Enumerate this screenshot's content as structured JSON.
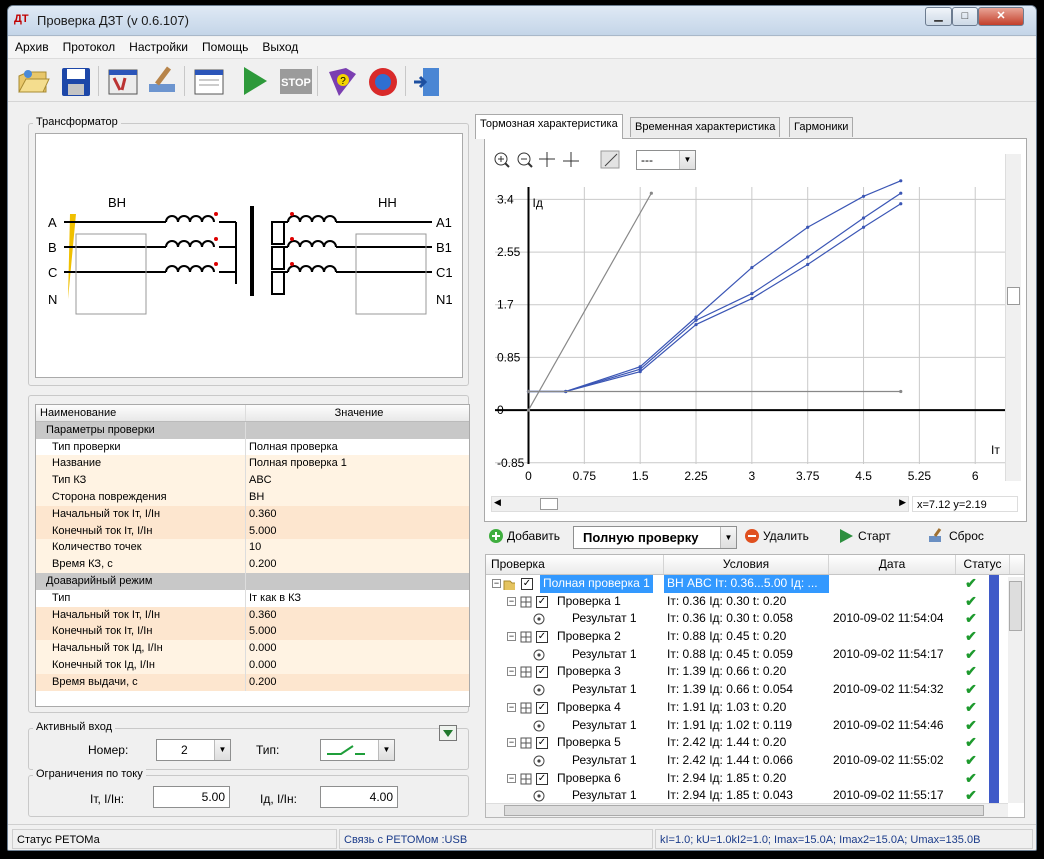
{
  "window": {
    "title": "Проверка ДЗТ (v 0.6.107)",
    "app_icon_text": "ДТ"
  },
  "menu": [
    "Архив",
    "Протокол",
    "Настройки",
    "Помощь",
    "Выход"
  ],
  "toolbar": [
    "open-folder-icon",
    "save-icon",
    "settings-icon",
    "brush-icon",
    "window-icon",
    "play-icon",
    "stop-icon",
    "help-book-icon",
    "lifebuoy-icon",
    "exit-door-icon"
  ],
  "toolbar_stop_label": "STOP",
  "transformer": {
    "legend": "Трансформатор",
    "hv_label": "ВН",
    "lv_label": "НН",
    "hv_phases": [
      "A",
      "B",
      "C",
      "N"
    ],
    "lv_phases": [
      "A1",
      "B1",
      "C1",
      "N1"
    ]
  },
  "params": {
    "col_name": "Наименование",
    "col_value": "Значение",
    "rows": [
      {
        "type": "section",
        "name": "Параметры проверки",
        "value": ""
      },
      {
        "type": "white",
        "name": "Тип проверки",
        "value": "Полная проверка"
      },
      {
        "type": "odd",
        "name": "Название",
        "value": "Полная проверка 1"
      },
      {
        "type": "odd",
        "name": "Тип КЗ",
        "value": "ABC"
      },
      {
        "type": "odd",
        "name": "Сторона повреждения",
        "value": "ВН"
      },
      {
        "type": "even",
        "name": "Начальный ток Iт, I/Iн",
        "value": "0.360"
      },
      {
        "type": "even",
        "name": "Конечный ток Iт, I/Iн",
        "value": "5.000"
      },
      {
        "type": "odd",
        "name": "Количество точек",
        "value": "10"
      },
      {
        "type": "odd",
        "name": "Время КЗ, с",
        "value": "0.200"
      },
      {
        "type": "section",
        "name": "Доаварийный режим",
        "value": ""
      },
      {
        "type": "white",
        "name": "Тип",
        "value": "Iт как в КЗ"
      },
      {
        "type": "even",
        "name": "Начальный ток Iт, I/Iн",
        "value": "0.360"
      },
      {
        "type": "even",
        "name": "Конечный ток Iт, I/Iн",
        "value": "5.000"
      },
      {
        "type": "odd",
        "name": "Начальный ток Iд, I/Iн",
        "value": "0.000"
      },
      {
        "type": "odd",
        "name": "Конечный ток Iд, I/Iн",
        "value": "0.000"
      },
      {
        "type": "even",
        "name": "Время выдачи, с",
        "value": "0.200"
      }
    ]
  },
  "active_input": {
    "legend": "Активный вход",
    "number_label": "Номер:",
    "number_value": "2",
    "type_label": "Тип:"
  },
  "limits": {
    "legend": "Ограничения по току",
    "it_label": "Iт, I/Iн:",
    "it_value": "5.00",
    "id_label": "Iд, I/Iн:",
    "id_value": "4.00"
  },
  "tabs": [
    "Тормозная характеристика",
    "Временная характеристика",
    "Гармоники"
  ],
  "chart_toolbar": {
    "select_value": "---"
  },
  "chart_data": {
    "type": "line",
    "xlabel": "Iт",
    "ylabel": "Iд",
    "xlim": [
      -0.45,
      6.4
    ],
    "ylim": [
      -0.87,
      3.6
    ],
    "x_ticks": [
      "0",
      "0.75",
      "1.5",
      "2.25",
      "3",
      "3.75",
      "4.5",
      "5.25",
      "6"
    ],
    "y_ticks": [
      "3.4",
      "2.55",
      "1.7",
      "0.85",
      "0",
      "-0.85"
    ],
    "grid": true,
    "series": [
      {
        "x": [
          0,
          0.5,
          1.5,
          2.25,
          3.0,
          3.75,
          4.5,
          5.0
        ],
        "y": [
          0.3,
          0.3,
          0.7,
          1.5,
          2.3,
          2.95,
          3.45,
          3.7
        ],
        "color": "#3b56b5"
      },
      {
        "x": [
          0,
          0.5,
          1.5,
          2.25,
          3.0,
          3.75,
          4.5,
          5.0
        ],
        "y": [
          0.3,
          0.3,
          0.66,
          1.45,
          1.88,
          2.47,
          3.1,
          3.5
        ],
        "color": "#3b56b5"
      },
      {
        "x": [
          0,
          0.5,
          1.5,
          2.25,
          3.0,
          3.75,
          4.5,
          5.0
        ],
        "y": [
          0.3,
          0.3,
          0.62,
          1.38,
          1.8,
          2.35,
          2.95,
          3.33
        ],
        "color": "#3b56b5"
      },
      {
        "x": [
          0,
          1.65
        ],
        "y": [
          0,
          3.5
        ],
        "color": "#888888"
      },
      {
        "x": [
          0,
          5.0
        ],
        "y": [
          0.3,
          0.3
        ],
        "color": "#888888"
      }
    ]
  },
  "chart_coord": "x=7.12  y=2.19",
  "tree_toolbar": {
    "add_label": "Добавить",
    "combo_value": "Полную проверку",
    "delete_label": "Удалить",
    "start_label": "Старт",
    "reset_label": "Сброс"
  },
  "tree": {
    "columns": [
      "Проверка",
      "Условия",
      "Дата",
      "Статус"
    ],
    "rows": [
      {
        "level": 0,
        "name": "Полная проверка 1",
        "cond": "ВН ABC  Iт: 0.36...5.00  Iд: ...",
        "date": "",
        "selected": true,
        "ok": true
      },
      {
        "level": 1,
        "name": "Проверка 1",
        "cond": "Iт: 0.36  Iд: 0.30  t: 0.20",
        "date": "",
        "ok": true
      },
      {
        "level": 2,
        "name": "Результат 1",
        "cond": "Iт: 0.36  Iд: 0.30  t: 0.058",
        "date": "2010-09-02 11:54:04",
        "ok": true
      },
      {
        "level": 1,
        "name": "Проверка 2",
        "cond": "Iт: 0.88  Iд: 0.45  t: 0.20",
        "date": "",
        "ok": true
      },
      {
        "level": 2,
        "name": "Результат 1",
        "cond": "Iт: 0.88  Iд: 0.45  t: 0.059",
        "date": "2010-09-02 11:54:17",
        "ok": true
      },
      {
        "level": 1,
        "name": "Проверка 3",
        "cond": "Iт: 1.39  Iд: 0.66  t: 0.20",
        "date": "",
        "ok": true
      },
      {
        "level": 2,
        "name": "Результат 1",
        "cond": "Iт: 1.39  Iд: 0.66  t: 0.054",
        "date": "2010-09-02 11:54:32",
        "ok": true
      },
      {
        "level": 1,
        "name": "Проверка 4",
        "cond": "Iт: 1.91  Iд: 1.03  t: 0.20",
        "date": "",
        "ok": true
      },
      {
        "level": 2,
        "name": "Результат 1",
        "cond": "Iт: 1.91  Iд: 1.02  t: 0.119",
        "date": "2010-09-02 11:54:46",
        "ok": true
      },
      {
        "level": 1,
        "name": "Проверка 5",
        "cond": "Iт: 2.42  Iд: 1.44  t: 0.20",
        "date": "",
        "ok": true
      },
      {
        "level": 2,
        "name": "Результат 1",
        "cond": "Iт: 2.42  Iд: 1.44  t: 0.066",
        "date": "2010-09-02 11:55:02",
        "ok": true
      },
      {
        "level": 1,
        "name": "Проверка 6",
        "cond": "Iт: 2.94  Iд: 1.85  t: 0.20",
        "date": "",
        "ok": true
      },
      {
        "level": 2,
        "name": "Результат 1",
        "cond": "Iт: 2.94  Iд: 1.85  t: 0.043",
        "date": "2010-09-02 11:55:17",
        "ok": true
      }
    ]
  },
  "status": {
    "left": "Статус РЕТОМа",
    "middle": "Связь с РЕТОМом :USB",
    "right": "kI=1.0; kU=1.0kI2=1.0; Imax=15.0A; Imax2=15.0A; Umax=135.0B"
  }
}
